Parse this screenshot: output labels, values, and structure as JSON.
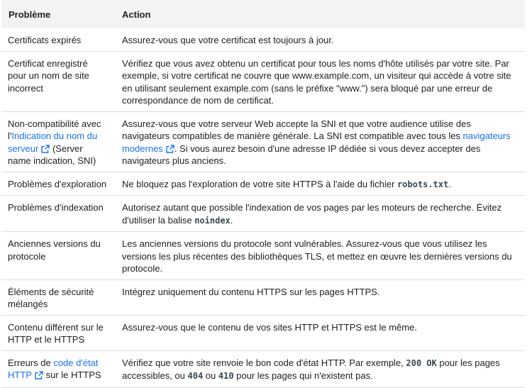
{
  "header": {
    "col1": "Problème",
    "col2": "Action"
  },
  "rows": [
    {
      "problem": "Certificats expirés",
      "action": "Assurez-vous que votre certificat est toujours à jour."
    },
    {
      "problem": "Certificat enregistré pour un nom de site incorrect",
      "action": "Vérifiez que vous avez obtenu un certificat pour tous les noms d'hôte utilisés par votre site. Par exemple, si votre certificat ne couvre que www.example.com, un visiteur qui accède à votre site en utilisant seulement example.com (sans le préfixe \"www.\") sera bloqué par une erreur de correspondance de nom de certificat."
    },
    {
      "problem_before": "Non-compatibilité avec l'",
      "problem_link": "Indication du nom du serveur",
      "problem_after": " (Server name indication, SNI)",
      "action_before": "Assurez-vous que votre serveur Web accepte la SNI et que votre audience utilise des navigateurs compatibles de manière générale. La SNI est compatible avec tous les ",
      "action_link": "navigateurs modernes",
      "action_after": ". Si vous aurez besoin d'une adresse IP dédiée si vous devez accepter des navigateurs plus anciens."
    },
    {
      "problem": "Problèmes d'exploration",
      "action_before": "Ne bloquez pas l'exploration de votre site HTTPS à l'aide du fichier ",
      "action_code": "robots.txt",
      "action_after": "."
    },
    {
      "problem": "Problèmes d'indexation",
      "action_before": "Autorisez autant que possible l'indexation de vos pages par les moteurs de recherche. Évitez d'utiliser la balise ",
      "action_code": "noindex",
      "action_after": "."
    },
    {
      "problem": "Anciennes versions du protocole",
      "action": "Les anciennes versions du protocole sont vulnérables. Assurez-vous que vous utilisez les versions les plus récentes des bibliothèques TLS, et mettez en œuvre les dernières versions du protocole."
    },
    {
      "problem": "Éléments de sécurité mélangés",
      "action": "Intégrez uniquement du contenu HTTPS sur les pages HTTPS."
    },
    {
      "problem": "Contenu différent sur le HTTP et le HTTPS",
      "action": "Assurez-vous que le contenu de vos sites HTTP et HTTPS est le même."
    },
    {
      "problem_before": "Erreurs de ",
      "problem_link": "code d'état HTTP",
      "problem_after": " sur le HTTPS",
      "action_before": "Vérifiez que votre site renvoie le bon code d'état HTTP. Par exemple, ",
      "code_200": "200 OK",
      "action_mid1": " pour les pages accessibles, ou ",
      "code_404": "404",
      "action_mid2": " ou ",
      "code_410": "410",
      "action_after": " pour les pages qui n'existent pas."
    }
  ],
  "colors": {
    "link": "#1a73e8",
    "header_bg": "#f1f3f4",
    "border": "#dadce0"
  },
  "icons": {
    "external_link": "external-link-icon"
  }
}
